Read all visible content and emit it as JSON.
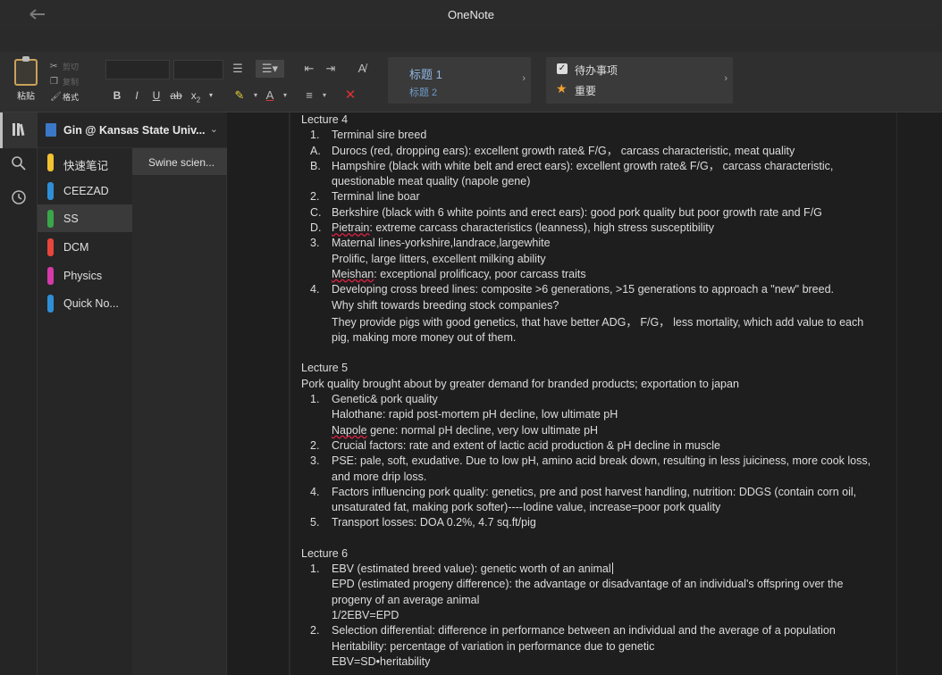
{
  "app": {
    "title": "OneNote"
  },
  "ribbon": {
    "paste_label": "粘贴",
    "cut_label": "剪切",
    "copy_label": "复制",
    "format_label": "格式",
    "bold": "B",
    "italic": "I",
    "underline": "U",
    "strike": "ab",
    "subscript": "x",
    "styles": {
      "heading1": "标题 1",
      "heading2": "标题 2"
    },
    "tags": {
      "todo": "待办事项",
      "important": "重要"
    }
  },
  "notebook": {
    "name": "Gin @ Kansas State Univ..."
  },
  "sections": [
    {
      "name": "快速笔记",
      "color": "#f2c230"
    },
    {
      "name": "CEEZAD",
      "color": "#2e8fd8"
    },
    {
      "name": "SS",
      "color": "#3aa64a"
    },
    {
      "name": "DCM",
      "color": "#e8453c"
    },
    {
      "name": "Physics",
      "color": "#d63aa8"
    },
    {
      "name": "Quick No...",
      "color": "#2e8fd8"
    }
  ],
  "pages": [
    {
      "name": "Swine scien..."
    }
  ],
  "note": {
    "l4_title": "Lecture 4",
    "l4_1": "Terminal sire breed",
    "l4_a": "Durocs (red, dropping ears): excellent growth rate& F/G， carcass characteristic, meat quality",
    "l4_b1": "Hampshire (black with white belt and erect ears): excellent growth rate& F/G， carcass characteristic,",
    "l4_b2": "questionable meat quality (napole gene)",
    "l4_2": "Terminal line boar",
    "l4_c": "Berkshire (black with 6 white points and erect ears): good pork quality but poor growth rate and F/G",
    "l4_d_w": "Pietrain",
    "l4_d": ": extreme carcass characteristics (leanness), high stress susceptibility",
    "l4_3": "Maternal lines-yorkshire,landrace,largewhite",
    "l4_3b": "Prolific, large litters, excellent milking ability",
    "l4_3c_w": "Meishan",
    "l4_3c": ": exceptional prolificacy, poor carcass traits",
    "l4_4": "Developing cross breed lines: composite >6 generations, >15 generations to approach a \"new\" breed.",
    "l4_4b": "Why shift towards breeding stock companies?",
    "l4_4c": "They provide pigs with good genetics, that have better ADG， F/G， less mortality, which add value to each",
    "l4_4d": "pig, making more money out of them.",
    "l5_title": "Lecture 5",
    "l5_intro": "Pork quality brought about by greater demand for branded products; exportation to japan",
    "l5_1": "Genetic& pork quality",
    "l5_1b": "Halothane: rapid post-mortem pH decline, low ultimate pH",
    "l5_1c_w": "Napole",
    "l5_1c": " gene: normal pH decline, very low ultimate pH",
    "l5_2": "Crucial factors: rate and extent of lactic acid production & pH decline in muscle",
    "l5_3": "PSE: pale, soft, exudative. Due to low pH, amino acid break down, resulting in  less juiciness, more cook loss,",
    "l5_3b": "and more drip loss.",
    "l5_4": "Factors influencing pork quality: genetics, pre and post harvest handling, nutrition: DDGS (contain corn oil,",
    "l5_4b": "unsaturated fat, making pork softer)----Iodine value, increase=poor pork quality",
    "l5_5": "Transport losses: DOA 0.2%, 4.7 sq.ft/pig",
    "l6_title": "Lecture 6",
    "l6_1": "EBV (estimated breed value): genetic worth of an animal",
    "l6_1b": "EPD (estimated progeny difference): the advantage or disadvantage of an individual's offspring over the",
    "l6_1c": "progeny of an average animal",
    "l6_1d": "1/2EBV=EPD",
    "l6_2": "Selection differential: difference in performance between an individual and the average of a population",
    "l6_2b": "Heritability: percentage of variation in performance due to genetic",
    "l6_2c": "EBV=SD•heritability",
    "n1": "1.",
    "n2": "2.",
    "n3": "3.",
    "n4": "4.",
    "n5": "5.",
    "la": "A.",
    "lb": "B.",
    "lc": "C.",
    "ld": "D."
  }
}
